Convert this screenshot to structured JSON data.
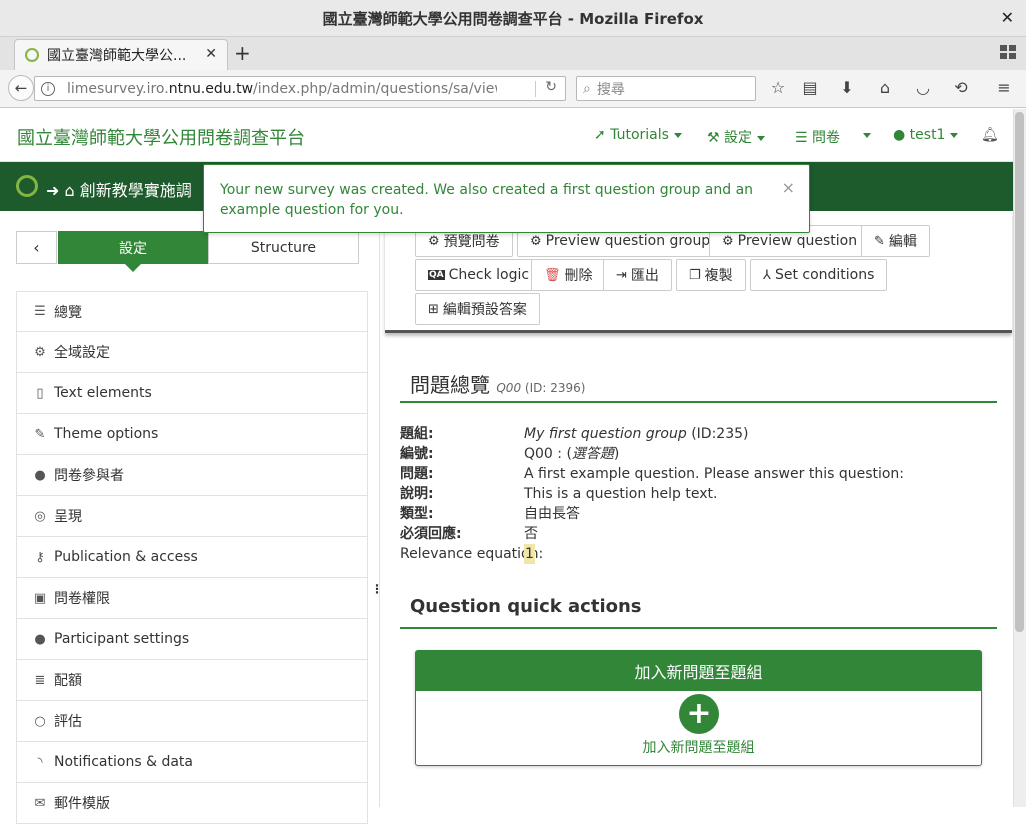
{
  "window": {
    "title": "國立臺灣師範大學公用問卷調查平台 - Mozilla Firefox"
  },
  "browser": {
    "tab_title": "國立臺灣師範大學公...",
    "url_prefix": "limesurvey.iro.",
    "url_domain": "ntnu.edu.tw",
    "url_path": "/index.php/admin/questions/sa/view/surve",
    "search_placeholder": "搜尋"
  },
  "app": {
    "brand": "國立臺灣師範大學公用問卷調查平台",
    "menu": {
      "tutorials": "Tutorials",
      "settings": "設定",
      "surveys": "問卷",
      "user": "test1"
    },
    "breadcrumb": "創新教學實施調"
  },
  "alert": {
    "text": "Your new survey was created. We also created a first question group and an example question for you."
  },
  "sidebar": {
    "tab_settings": "設定",
    "tab_structure": "Structure",
    "items": [
      {
        "label": "總覽",
        "icon": "list-icon"
      },
      {
        "label": "全域設定",
        "icon": "cogs-icon"
      },
      {
        "label": "Text elements",
        "icon": "file-text-icon"
      },
      {
        "label": "Theme options",
        "icon": "paint-brush-icon"
      },
      {
        "label": "問卷參與者",
        "icon": "user-icon"
      },
      {
        "label": "呈現",
        "icon": "eye-slash-icon"
      },
      {
        "label": "Publication & access",
        "icon": "key-icon"
      },
      {
        "label": "問卷權限",
        "icon": "lock-icon"
      },
      {
        "label": "Participant settings",
        "icon": "users-icon"
      },
      {
        "label": "配額",
        "icon": "tasks-icon"
      },
      {
        "label": "評估",
        "icon": "comment-icon"
      },
      {
        "label": "Notifications & data",
        "icon": "rss-icon"
      },
      {
        "label": "郵件模版",
        "icon": "envelope-icon"
      }
    ]
  },
  "actions": {
    "preview_survey": "預覽問卷",
    "preview_group": "Preview question group",
    "preview_question": "Preview question",
    "edit": "編輯",
    "check_logic": "Check logic",
    "delete": "刪除",
    "export": "匯出",
    "copy": "複製",
    "set_conditions": "Set conditions",
    "edit_default_answers": "編輯預設答案"
  },
  "overview": {
    "title": "問題總覽",
    "code": "Q00",
    "id_text": "(ID: 2396)",
    "fields": {
      "group_label": "題組:",
      "group_name": "My first question group",
      "group_id": "(ID:235)",
      "code_label": "編號:",
      "code_value": "Q00 : (",
      "code_optional": "選答題",
      "code_close": ")",
      "question_label": "問題:",
      "question_value": "A first example question. Please answer this question:",
      "help_label": "說明:",
      "help_value": "This is a question help text.",
      "type_label": "類型:",
      "type_value": "自由長答",
      "mandatory_label": "必須回應:",
      "mandatory_value": "否",
      "relevance_label": "Relevance equation:",
      "relevance_value": "1"
    }
  },
  "quick_actions": {
    "title": "Question quick actions",
    "card_header": "加入新問題至題組",
    "card_label": "加入新問題至題組"
  },
  "colors": {
    "primary": "#328637",
    "dark_green": "#1d5a2c"
  }
}
